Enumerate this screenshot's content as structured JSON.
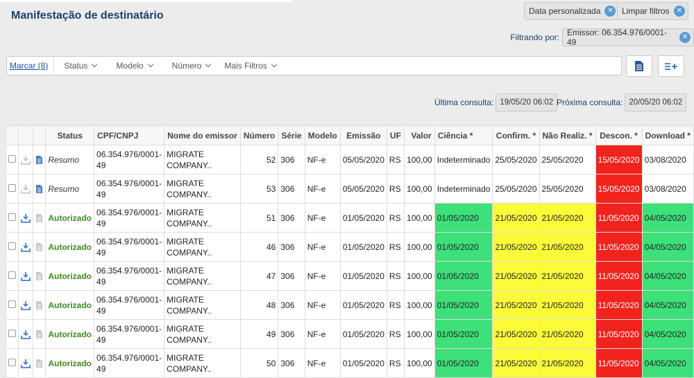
{
  "page": {
    "title": "Manifestação de destinatário"
  },
  "filters": {
    "chips": [
      {
        "label": "Data personalizada"
      },
      {
        "label": "Limpar filtros"
      }
    ],
    "filtering_label": "Filtrando por:",
    "active_filter": "Emissor: 06.354.976/0001-49"
  },
  "toolbar": {
    "mark_label": "Marcar (8)",
    "dropdowns": [
      "Status",
      "Modelo",
      "Número",
      "Mais Filtros"
    ]
  },
  "consult": {
    "last_label": "Última consulta:",
    "last_value": "19/05/20 06:02",
    "next_label": "Próxima consulta:",
    "next_value": "20/05/20 06:02"
  },
  "table": {
    "headers": [
      "",
      "",
      "",
      "Status",
      "CPF/CNPJ",
      "Nome do emissor",
      "Número",
      "Série",
      "Modelo",
      "Emissão",
      "UF",
      "Valor",
      "Ciência *",
      "Confirm. *",
      "Não Realiz. *",
      "Descon. *",
      "Download *"
    ],
    "rows": [
      {
        "status": "Resumo",
        "cnpj": "06.354.976/0001-49",
        "name": "MIGRATE COMPANY..",
        "number": "52",
        "serie": "306",
        "model": "NF-e",
        "emission": "05/05/2020",
        "uf": "RS",
        "value": "100,00",
        "ciencia": "Indeterminado",
        "confirm": "25/05/2020",
        "nao_realiz": "25/05/2020",
        "descon": "15/05/2020",
        "download": "03/08/2020",
        "ciencia_color": "none",
        "confirm_color": "none",
        "nao_color": "none",
        "descon_color": "red",
        "download_color": "none",
        "doc_color": "#4a7ec2",
        "dl_color": "#c8c8c8"
      },
      {
        "status": "Resumo",
        "cnpj": "06.354.976/0001-49",
        "name": "MIGRATE COMPANY..",
        "number": "53",
        "serie": "306",
        "model": "NF-e",
        "emission": "05/05/2020",
        "uf": "RS",
        "value": "100,00",
        "ciencia": "Indeterminado",
        "confirm": "25/05/2020",
        "nao_realiz": "25/05/2020",
        "descon": "15/05/2020",
        "download": "03/08/2020",
        "ciencia_color": "none",
        "confirm_color": "none",
        "nao_color": "none",
        "descon_color": "red",
        "download_color": "none",
        "doc_color": "#4a7ec2",
        "dl_color": "#c8c8c8"
      },
      {
        "status": "Autorizado",
        "cnpj": "06.354.976/0001-49",
        "name": "MIGRATE COMPANY..",
        "number": "51",
        "serie": "306",
        "model": "NF-e",
        "emission": "01/05/2020",
        "uf": "RS",
        "value": "100,00",
        "ciencia": "01/05/2020",
        "confirm": "21/05/2020",
        "nao_realiz": "21/05/2020",
        "descon": "11/05/2020",
        "download": "04/05/2020",
        "ciencia_color": "green",
        "confirm_color": "yellow",
        "nao_color": "yellow",
        "descon_color": "red",
        "download_color": "green",
        "doc_color": "#c8c8c8",
        "dl_color": "#4a7ec2"
      },
      {
        "status": "Autorizado",
        "cnpj": "06.354.976/0001-49",
        "name": "MIGRATE COMPANY..",
        "number": "46",
        "serie": "306",
        "model": "NF-e",
        "emission": "01/05/2020",
        "uf": "RS",
        "value": "100,00",
        "ciencia": "01/05/2020",
        "confirm": "21/05/2020",
        "nao_realiz": "21/05/2020",
        "descon": "11/05/2020",
        "download": "04/05/2020",
        "ciencia_color": "green",
        "confirm_color": "yellow",
        "nao_color": "yellow",
        "descon_color": "red",
        "download_color": "green",
        "doc_color": "#c8c8c8",
        "dl_color": "#4a7ec2"
      },
      {
        "status": "Autorizado",
        "cnpj": "06.354.976/0001-49",
        "name": "MIGRATE COMPANY..",
        "number": "47",
        "serie": "306",
        "model": "NF-e",
        "emission": "01/05/2020",
        "uf": "RS",
        "value": "100,00",
        "ciencia": "01/05/2020",
        "confirm": "21/05/2020",
        "nao_realiz": "21/05/2020",
        "descon": "11/05/2020",
        "download": "04/05/2020",
        "ciencia_color": "green",
        "confirm_color": "yellow",
        "nao_color": "yellow",
        "descon_color": "red",
        "download_color": "green",
        "doc_color": "#c8c8c8",
        "dl_color": "#4a7ec2"
      },
      {
        "status": "Autorizado",
        "cnpj": "06.354.976/0001-49",
        "name": "MIGRATE COMPANY..",
        "number": "48",
        "serie": "306",
        "model": "NF-e",
        "emission": "01/05/2020",
        "uf": "RS",
        "value": "100,00",
        "ciencia": "01/05/2020",
        "confirm": "21/05/2020",
        "nao_realiz": "21/05/2020",
        "descon": "11/05/2020",
        "download": "04/05/2020",
        "ciencia_color": "green",
        "confirm_color": "yellow",
        "nao_color": "yellow",
        "descon_color": "red",
        "download_color": "green",
        "doc_color": "#c8c8c8",
        "dl_color": "#4a7ec2"
      },
      {
        "status": "Autorizado",
        "cnpj": "06.354.976/0001-49",
        "name": "MIGRATE COMPANY..",
        "number": "49",
        "serie": "306",
        "model": "NF-e",
        "emission": "01/05/2020",
        "uf": "RS",
        "value": "100,00",
        "ciencia": "01/05/2020",
        "confirm": "21/05/2020",
        "nao_realiz": "21/05/2020",
        "descon": "11/05/2020",
        "download": "04/05/2020",
        "ciencia_color": "green",
        "confirm_color": "yellow",
        "nao_color": "yellow",
        "descon_color": "red",
        "download_color": "green",
        "doc_color": "#c8c8c8",
        "dl_color": "#4a7ec2"
      },
      {
        "status": "Autorizado",
        "cnpj": "06.354.976/0001-49",
        "name": "MIGRATE COMPANY..",
        "number": "50",
        "serie": "306",
        "model": "NF-e",
        "emission": "01/05/2020",
        "uf": "RS",
        "value": "100,00",
        "ciencia": "01/05/2020",
        "confirm": "21/05/2020",
        "nao_realiz": "21/05/2020",
        "descon": "11/05/2020",
        "download": "04/05/2020",
        "ciencia_color": "green",
        "confirm_color": "yellow",
        "nao_color": "yellow",
        "descon_color": "red",
        "download_color": "green",
        "doc_color": "#c8c8c8",
        "dl_color": "#4a7ec2"
      }
    ]
  }
}
